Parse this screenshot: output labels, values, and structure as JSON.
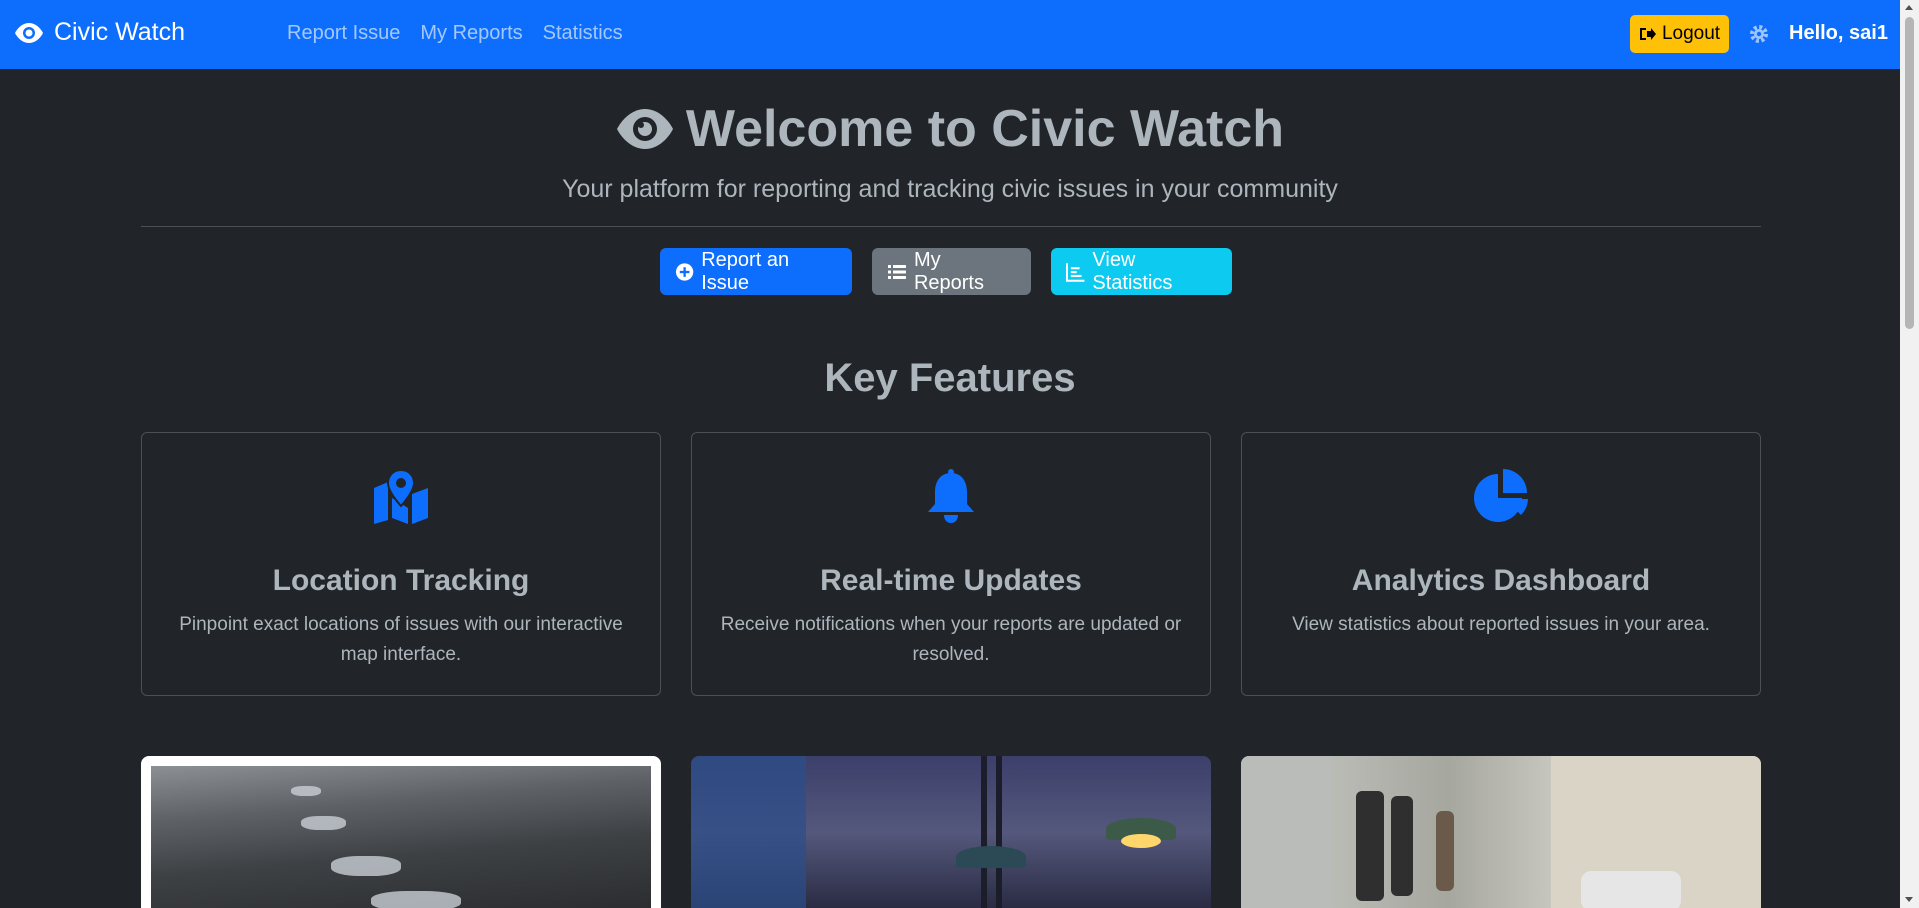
{
  "navbar": {
    "brand": "Civic Watch",
    "links": [
      "Report Issue",
      "My Reports",
      "Statistics"
    ],
    "logout_label": "Logout",
    "greeting": "Hello, sai1"
  },
  "hero": {
    "title": "Welcome to Civic Watch",
    "subtitle": "Your platform for reporting and tracking civic issues in your community",
    "buttons": {
      "report": "Report an Issue",
      "my_reports": "My Reports",
      "stats": "View Statistics"
    }
  },
  "features": {
    "title": "Key Features",
    "cards": [
      {
        "icon": "map-location-icon",
        "title": "Location Tracking",
        "text": "Pinpoint exact locations of issues with our interactive map interface."
      },
      {
        "icon": "bell-icon",
        "title": "Real-time Updates",
        "text": "Receive notifications when your reports are updated or resolved."
      },
      {
        "icon": "pie-chart-icon",
        "title": "Analytics Dashboard",
        "text": "View statistics about reported issues in your area."
      }
    ]
  },
  "colors": {
    "navbar": "#0d6efd",
    "background": "#212529",
    "logout": "#ffc107",
    "primary": "#0d6efd",
    "secondary": "#6c757d",
    "info": "#0dcaf0"
  }
}
